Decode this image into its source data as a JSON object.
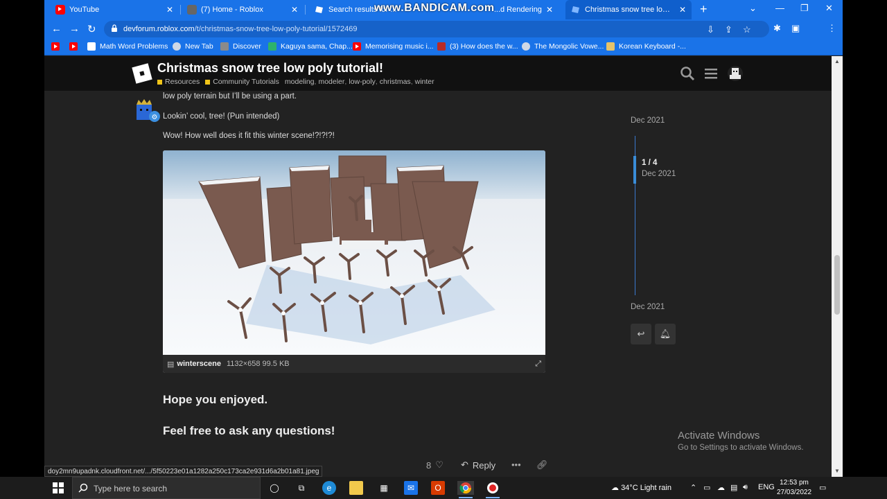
{
  "browser": {
    "tabs": [
      {
        "label": "YouTube",
        "icon": "youtube-icon"
      },
      {
        "label": "(7) Home - Roblox",
        "icon": "roblox-icon"
      },
      {
        "label": "Search results for ...",
        "icon": "devforum-icon"
      },
      {
        "label": "...d Rendering",
        "icon": "devforum-icon"
      },
      {
        "label": "Christmas snow tree low poly tu",
        "icon": "devforum-icon"
      }
    ],
    "watermark": "www.BANDICAM.com",
    "url_host": "devforum.roblox.com",
    "url_path": "/t/christmas-snow-tree-low-poly-tutorial/1572469",
    "bookmarks": [
      {
        "label": "Math Word Problems",
        "icon": "doc-icon"
      },
      {
        "label": "New Tab",
        "icon": "globe-icon"
      },
      {
        "label": "Discover",
        "icon": "doc-icon"
      },
      {
        "label": "Kaguya sama, Chap...",
        "icon": "bookmark-icon"
      },
      {
        "label": "Memorising music i...",
        "icon": "youtube-icon"
      },
      {
        "label": "(3) How does the w...",
        "icon": "quora-icon"
      },
      {
        "label": "The Mongolic Vowe...",
        "icon": "globe-icon"
      },
      {
        "label": "Korean Keyboard -...",
        "icon": "keyboard-icon"
      }
    ]
  },
  "topic": {
    "title": "Christmas snow tree low poly tutorial!",
    "categories": [
      "Resources",
      "Community Tutorials"
    ],
    "tags": [
      "modeling",
      "modeler",
      "low-poly",
      "christmas",
      "winter"
    ]
  },
  "post": {
    "line1": "low poly terrain but I’ll be using a part.",
    "line2": "Lookin’ cool, tree! (Pun intended)",
    "line3": "Wow! How well does it fit this winter scene!?!?!?!",
    "image_name": "winterscene",
    "image_meta": "1132×658 99.5 KB",
    "closing1": "Hope you enjoyed.",
    "closing2": "Feel free to ask any questions!",
    "likes": "8",
    "reply": "Reply"
  },
  "timeline": {
    "top_date": "Dec 2021",
    "position": "1 / 4",
    "position_date": "Dec 2021",
    "bottom_date": "Dec 2021",
    "progress": 0.25
  },
  "activation": {
    "title": "Activate Windows",
    "subtitle": "Go to Settings to activate Windows."
  },
  "status_url": "doy2mn9upadnk.cloudfront.net/.../5f50223e01a1282a250c173ca2e931d6a2b01a81.jpeg",
  "taskbar": {
    "search_placeholder": "Type here to search",
    "weather": "34°C  Light rain",
    "lang": "ENG",
    "time": "12:53 pm",
    "date": "27/03/2022"
  }
}
